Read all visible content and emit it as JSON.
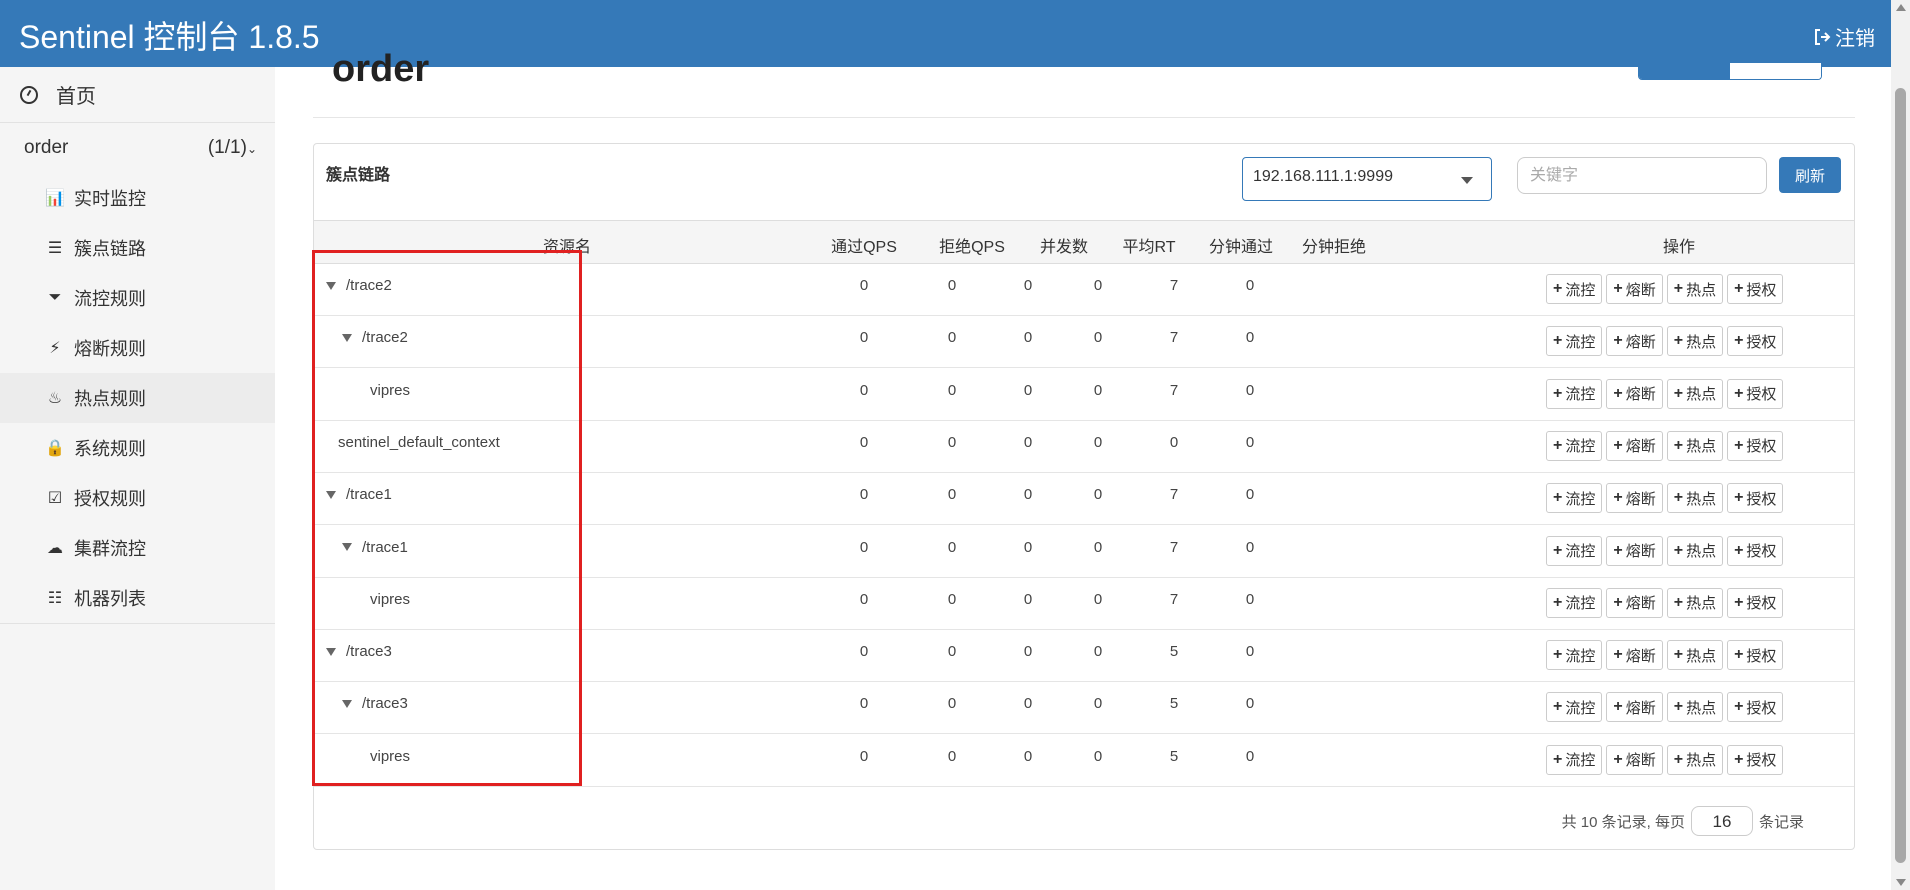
{
  "header": {
    "title": "Sentinel 控制台 1.8.5",
    "logout_label": "注销"
  },
  "sidebar": {
    "home_label": "首页",
    "app_name": "order",
    "app_count": "(1/1)",
    "items": [
      {
        "label": "实时监控",
        "icon": "bar-chart-icon",
        "glyph": "📊"
      },
      {
        "label": "簇点链路",
        "icon": "list-icon",
        "glyph": "☰"
      },
      {
        "label": "流控规则",
        "icon": "filter-icon",
        "glyph": "⏷"
      },
      {
        "label": "熔断规则",
        "icon": "flash-icon",
        "glyph": "⚡"
      },
      {
        "label": "热点规则",
        "icon": "fire-icon",
        "glyph": "♨"
      },
      {
        "label": "系统规则",
        "icon": "lock-icon",
        "glyph": "🔒"
      },
      {
        "label": "授权规则",
        "icon": "check-icon",
        "glyph": "☑"
      },
      {
        "label": "集群流控",
        "icon": "cloud-icon",
        "glyph": "☁"
      },
      {
        "label": "机器列表",
        "icon": "th-list-icon",
        "glyph": "☷"
      }
    ]
  },
  "main": {
    "page_title": "order",
    "toggle": [
      "",
      ""
    ],
    "panel_title": "簇点链路",
    "machine_select": "192.168.111.1:9999",
    "search_placeholder": "关键字",
    "refresh_label": "刷新",
    "columns": [
      "资源名",
      "通过QPS",
      "拒绝QPS",
      "并发数",
      "平均RT",
      "分钟通过",
      "分钟拒绝",
      "操作"
    ],
    "op_labels": [
      "流控",
      "熔断",
      "热点",
      "授权"
    ],
    "rows": [
      {
        "name": "/trace2",
        "level": 0,
        "toggle": true,
        "values": [
          "0",
          "0",
          "0",
          "0",
          "7",
          "0"
        ]
      },
      {
        "name": "/trace2",
        "level": 1,
        "toggle": true,
        "values": [
          "0",
          "0",
          "0",
          "0",
          "7",
          "0"
        ]
      },
      {
        "name": "vipres",
        "level": 2,
        "toggle": false,
        "values": [
          "0",
          "0",
          "0",
          "0",
          "7",
          "0"
        ]
      },
      {
        "name": "sentinel_default_context",
        "level": 0,
        "toggle": false,
        "values": [
          "0",
          "0",
          "0",
          "0",
          "0",
          "0"
        ]
      },
      {
        "name": "/trace1",
        "level": 0,
        "toggle": true,
        "values": [
          "0",
          "0",
          "0",
          "0",
          "7",
          "0"
        ]
      },
      {
        "name": "/trace1",
        "level": 1,
        "toggle": true,
        "values": [
          "0",
          "0",
          "0",
          "0",
          "7",
          "0"
        ]
      },
      {
        "name": "vipres",
        "level": 2,
        "toggle": false,
        "values": [
          "0",
          "0",
          "0",
          "0",
          "7",
          "0"
        ]
      },
      {
        "name": "/trace3",
        "level": 0,
        "toggle": true,
        "values": [
          "0",
          "0",
          "0",
          "0",
          "5",
          "0"
        ]
      },
      {
        "name": "/trace3",
        "level": 1,
        "toggle": true,
        "values": [
          "0",
          "0",
          "0",
          "0",
          "5",
          "0"
        ]
      },
      {
        "name": "vipres",
        "level": 2,
        "toggle": false,
        "values": [
          "0",
          "0",
          "0",
          "0",
          "5",
          "0"
        ]
      }
    ],
    "footer": {
      "prefix": "共 10 条记录, 每页",
      "page_size": "16",
      "suffix": "条记录"
    }
  },
  "colors": {
    "primary": "#3579b8",
    "highlight": "#e02020"
  }
}
